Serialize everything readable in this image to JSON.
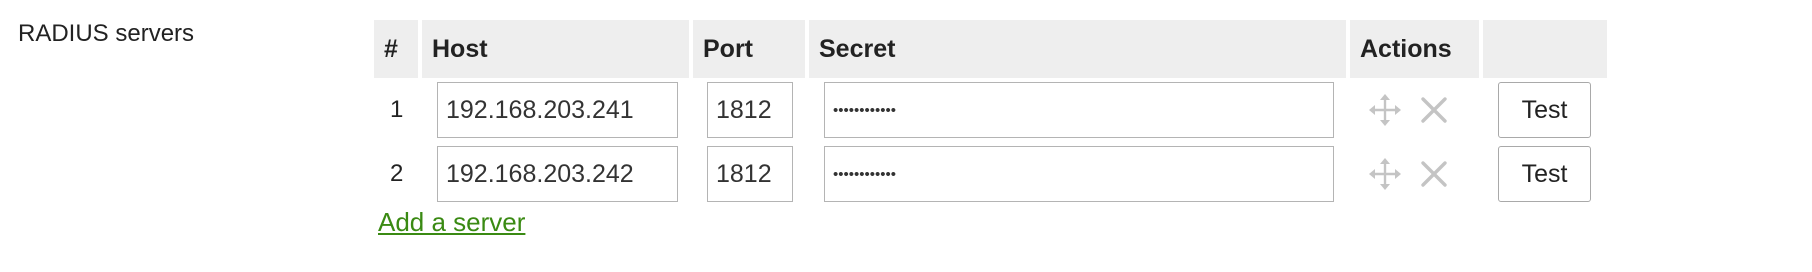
{
  "section": {
    "label": "RADIUS servers"
  },
  "table": {
    "headers": {
      "num": "#",
      "host": "Host",
      "port": "Port",
      "secret": "Secret",
      "actions": "Actions",
      "test": ""
    },
    "rows": [
      {
        "num": "1",
        "host": "192.168.203.241",
        "port": "1812",
        "secret": "••••••••••••",
        "test_label": "Test"
      },
      {
        "num": "2",
        "host": "192.168.203.242",
        "port": "1812",
        "secret": "••••••••••••",
        "test_label": "Test"
      }
    ]
  },
  "add_server": {
    "label": "Add a server"
  },
  "icons": {
    "move": "move-icon",
    "delete": "close-icon"
  },
  "colors": {
    "link": "#3a8a13",
    "header_bg": "#eeeeee",
    "icon": "#c4c4c4"
  }
}
